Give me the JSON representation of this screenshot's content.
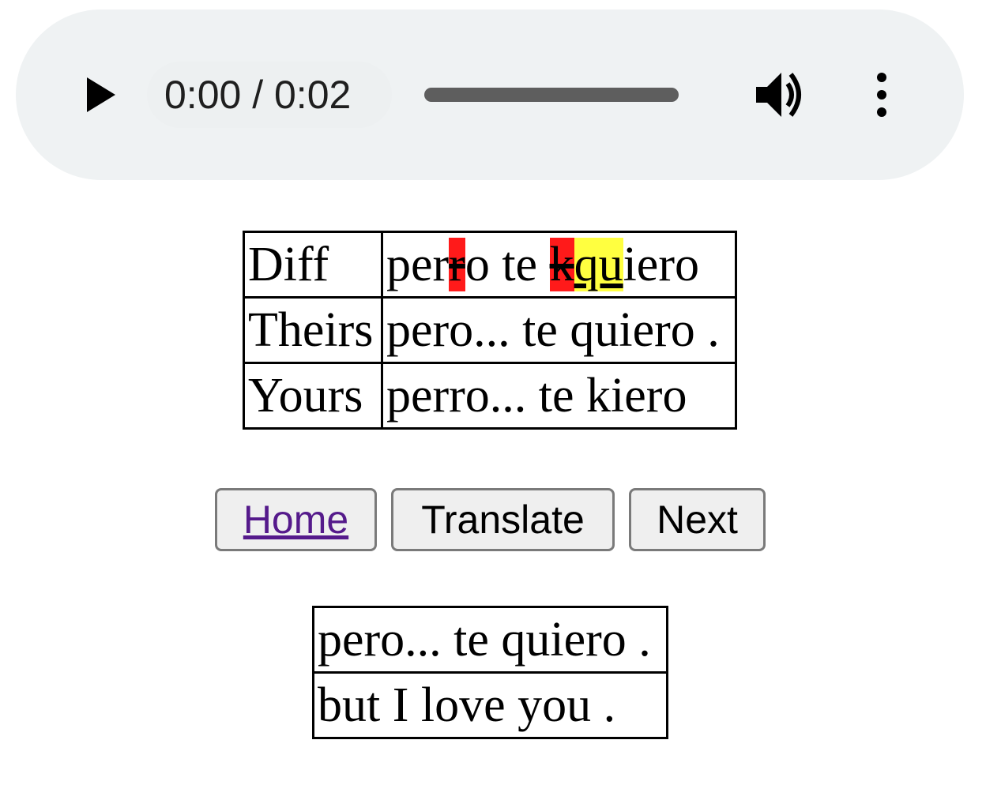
{
  "player": {
    "time_display": "0:00 / 0:02"
  },
  "diff_table": {
    "diff_label": "Diff",
    "diff_segments": {
      "s1": "per",
      "s2_del": "r",
      "s3": "o te ",
      "s4_del": "k",
      "s5_ins": "qu",
      "s6": "iero"
    },
    "theirs_label": "Theirs",
    "theirs_text": "pero... te quiero .",
    "yours_label": "Yours",
    "yours_text": "perro... te kiero"
  },
  "buttons": {
    "home": "Home",
    "translate": "Translate",
    "next": "Next"
  },
  "translation": {
    "source": "pero... te quiero .",
    "target": "but I love you ."
  },
  "colors": {
    "deletion": "#ff1a1a",
    "insertion": "#ffff40",
    "link": "#551a8b",
    "player_bg": "#eff2f3"
  }
}
